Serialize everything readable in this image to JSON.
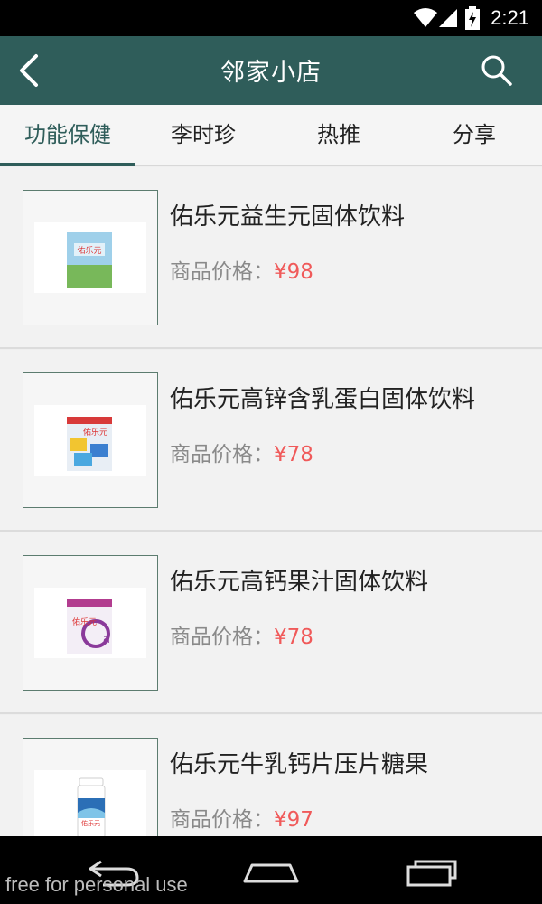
{
  "status_bar": {
    "time": "2:21"
  },
  "app_bar": {
    "title": "邻家小店"
  },
  "tabs": [
    {
      "label": "功能保健",
      "active": true
    },
    {
      "label": "李时珍",
      "active": false
    },
    {
      "label": "热推",
      "active": false
    },
    {
      "label": "分享",
      "active": false
    }
  ],
  "products": [
    {
      "name": "佑乐元益生元固体饮料",
      "price_label": "商品价格：",
      "price": "¥98"
    },
    {
      "name": "佑乐元高锌含乳蛋白固体饮料",
      "price_label": "商品价格：",
      "price": "¥78"
    },
    {
      "name": "佑乐元高钙果汁固体饮料",
      "price_label": "商品价格：",
      "price": "¥78"
    },
    {
      "name": "佑乐元牛乳钙片压片糖果",
      "price_label": "商品价格：",
      "price": "¥97"
    }
  ],
  "watermark": "free for personal use",
  "colors": {
    "primary": "#2f5d5a",
    "price": "#f05a5a"
  }
}
